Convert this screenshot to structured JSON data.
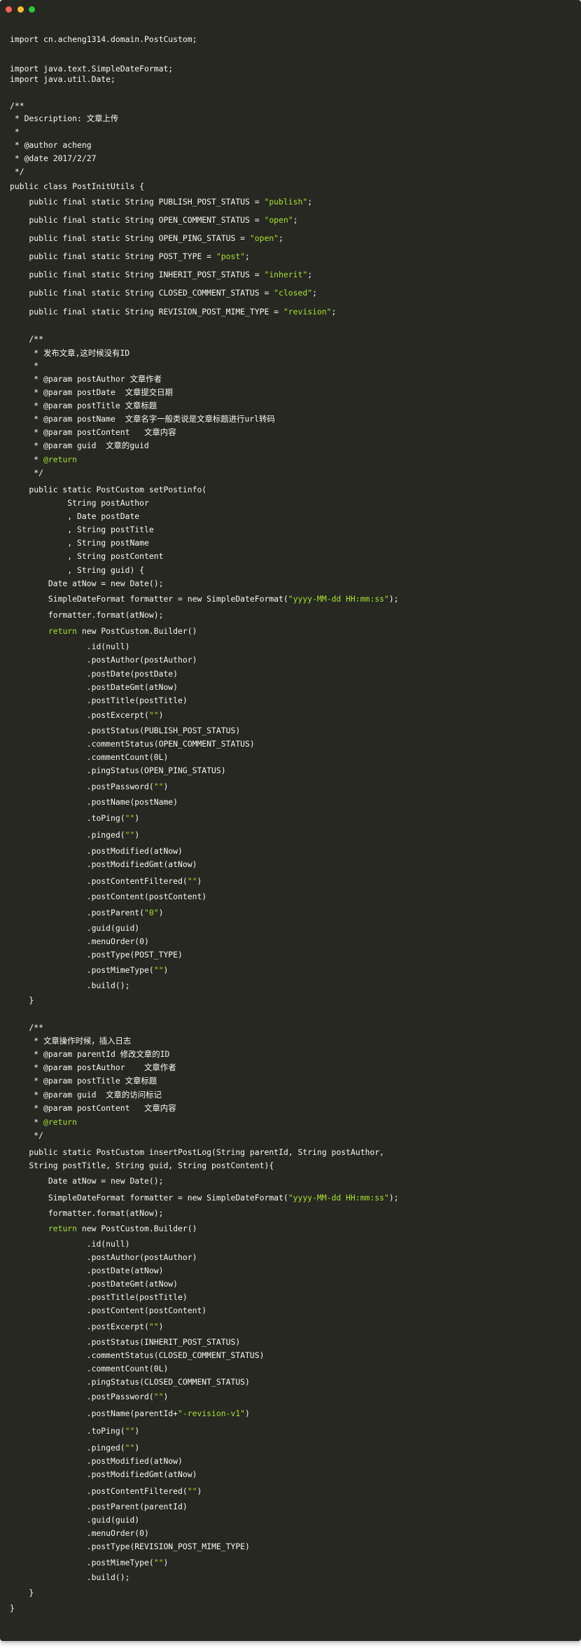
{
  "window": {
    "controls": [
      "close",
      "minimize",
      "maximize"
    ],
    "colors": {
      "background": "#272822",
      "text": "#f8f8f2",
      "string": "#a6e22e",
      "close": "#ff5f56",
      "minimize": "#ffbd2e",
      "maximize": "#27c93f"
    }
  },
  "code": {
    "language": "java",
    "lines": [
      {
        "text": "import cn.acheng1314.domain.PostCustom;"
      },
      {
        "text": "import java.text.SimpleDateFormat;"
      },
      {
        "text": "import java.util.Date;"
      },
      {
        "text": "/**"
      },
      {
        "text": " * Description: 文章上传"
      },
      {
        "text": " *"
      },
      {
        "text": " * @author acheng"
      },
      {
        "text": " * @date 2017/2/27"
      },
      {
        "text": " */"
      },
      {
        "text": "public class PostInitUtils {"
      },
      {
        "parts": [
          {
            "t": "    public final static String PUBLISH_POST_STATUS = "
          },
          {
            "t": "\"publish\"",
            "c": "str"
          },
          {
            "t": ";"
          }
        ]
      },
      {
        "parts": [
          {
            "t": "    public final static String OPEN_COMMENT_STATUS = "
          },
          {
            "t": "\"open\"",
            "c": "str"
          },
          {
            "t": ";"
          }
        ]
      },
      {
        "parts": [
          {
            "t": "    public final static String OPEN_PING_STATUS = "
          },
          {
            "t": "\"open\"",
            "c": "str"
          },
          {
            "t": ";"
          }
        ]
      },
      {
        "parts": [
          {
            "t": "    public final static String POST_TYPE = "
          },
          {
            "t": "\"post\"",
            "c": "str"
          },
          {
            "t": ";"
          }
        ]
      },
      {
        "parts": [
          {
            "t": "    public final static String INHERIT_POST_STATUS = "
          },
          {
            "t": "\"inherit\"",
            "c": "str"
          },
          {
            "t": ";"
          }
        ]
      },
      {
        "parts": [
          {
            "t": "    public final static String CLOSED_COMMENT_STATUS = "
          },
          {
            "t": "\"closed\"",
            "c": "str"
          },
          {
            "t": ";"
          }
        ]
      },
      {
        "parts": [
          {
            "t": "    public final static String REVISION_POST_MIME_TYPE = "
          },
          {
            "t": "\"revision\"",
            "c": "str"
          },
          {
            "t": ";"
          }
        ]
      },
      {
        "text": "    /**"
      },
      {
        "text": "     * 发布文章,这时候没有ID"
      },
      {
        "text": "     *"
      },
      {
        "text": "     * @param postAuthor 文章作者"
      },
      {
        "text": "     * @param postDate  文章提交日期"
      },
      {
        "text": "     * @param postTitle 文章标题"
      },
      {
        "text": "     * @param postName  文章名字一般类说是文章标题进行url转码"
      },
      {
        "text": "     * @param postContent   文章内容"
      },
      {
        "text": "     * @param guid  文章的guid"
      },
      {
        "parts": [
          {
            "t": "     * "
          },
          {
            "t": "@return",
            "c": "kw"
          }
        ]
      },
      {
        "text": "     */"
      },
      {
        "text": "    public static PostCustom setPostinfo("
      },
      {
        "text": "            String postAuthor"
      },
      {
        "text": "            , Date postDate"
      },
      {
        "text": "            , String postTitle"
      },
      {
        "text": "            , String postName"
      },
      {
        "text": "            , String postContent"
      },
      {
        "text": "            , String guid) {"
      },
      {
        "text": "        Date atNow = new Date();"
      },
      {
        "parts": [
          {
            "t": "        SimpleDateFormat formatter = new SimpleDateFormat("
          },
          {
            "t": "\"yyyy-MM-dd HH:mm:ss\"",
            "c": "str"
          },
          {
            "t": ");"
          }
        ]
      },
      {
        "text": "        formatter.format(atNow);"
      },
      {
        "parts": [
          {
            "t": "        "
          },
          {
            "t": "return",
            "c": "kw"
          },
          {
            "t": " new PostCustom.Builder()"
          }
        ]
      },
      {
        "text": "                .id(null)"
      },
      {
        "text": "                .postAuthor(postAuthor)"
      },
      {
        "text": "                .postDate(postDate)"
      },
      {
        "text": "                .postDateGmt(atNow)"
      },
      {
        "text": "                .postTitle(postTitle)"
      },
      {
        "parts": [
          {
            "t": "                .postExcerpt("
          },
          {
            "t": "\"\"",
            "c": "str"
          },
          {
            "t": ")"
          }
        ]
      },
      {
        "text": "                .postStatus(PUBLISH_POST_STATUS)"
      },
      {
        "text": "                .commentStatus(OPEN_COMMENT_STATUS)"
      },
      {
        "text": "                .commentCount(0L)"
      },
      {
        "text": "                .pingStatus(OPEN_PING_STATUS)"
      },
      {
        "parts": [
          {
            "t": "                .postPassword("
          },
          {
            "t": "\"\"",
            "c": "str"
          },
          {
            "t": ")"
          }
        ]
      },
      {
        "text": "                .postName(postName)"
      },
      {
        "parts": [
          {
            "t": "                .toPing("
          },
          {
            "t": "\"\"",
            "c": "str"
          },
          {
            "t": ")"
          }
        ]
      },
      {
        "parts": [
          {
            "t": "                .pinged("
          },
          {
            "t": "\"\"",
            "c": "str"
          },
          {
            "t": ")"
          }
        ]
      },
      {
        "text": "                .postModified(atNow)"
      },
      {
        "text": "                .postModifiedGmt(atNow)"
      },
      {
        "parts": [
          {
            "t": "                .postContentFiltered("
          },
          {
            "t": "\"\"",
            "c": "str"
          },
          {
            "t": ")"
          }
        ]
      },
      {
        "text": "                .postContent(postContent)"
      },
      {
        "parts": [
          {
            "t": "                .postParent("
          },
          {
            "t": "\"0\"",
            "c": "str"
          },
          {
            "t": ")"
          }
        ]
      },
      {
        "text": "                .guid(guid)"
      },
      {
        "text": "                .menuOrder(0)"
      },
      {
        "text": "                .postType(POST_TYPE)"
      },
      {
        "parts": [
          {
            "t": "                .postMimeType("
          },
          {
            "t": "\"\"",
            "c": "str"
          },
          {
            "t": ")"
          }
        ]
      },
      {
        "text": "                .build();"
      },
      {
        "text": "    }"
      },
      {
        "text": "    /**"
      },
      {
        "text": "     * 文章操作时候，插入日志"
      },
      {
        "text": "     * @param parentId 修改文章的ID"
      },
      {
        "text": "     * @param postAuthor    文章作者"
      },
      {
        "text": "     * @param postTitle 文章标题"
      },
      {
        "text": "     * @param guid  文章的访问标记"
      },
      {
        "text": "     * @param postContent   文章内容"
      },
      {
        "parts": [
          {
            "t": "     * "
          },
          {
            "t": "@return",
            "c": "kw"
          }
        ]
      },
      {
        "text": "     */"
      },
      {
        "text": "    public static PostCustom insertPostLog(String parentId, String postAuthor,"
      },
      {
        "text": "    String postTitle, String guid, String postContent){"
      },
      {
        "text": "        Date atNow = new Date();"
      },
      {
        "parts": [
          {
            "t": "        SimpleDateFormat formatter = new SimpleDateFormat("
          },
          {
            "t": "\"yyyy-MM-dd HH:mm:ss\"",
            "c": "str"
          },
          {
            "t": ");"
          }
        ]
      },
      {
        "text": "        formatter.format(atNow);"
      },
      {
        "parts": [
          {
            "t": "        "
          },
          {
            "t": "return",
            "c": "kw"
          },
          {
            "t": " new PostCustom.Builder()"
          }
        ]
      },
      {
        "text": "                .id(null)"
      },
      {
        "text": "                .postAuthor(postAuthor)"
      },
      {
        "text": "                .postDate(atNow)"
      },
      {
        "text": "                .postDateGmt(atNow)"
      },
      {
        "text": "                .postTitle(postTitle)"
      },
      {
        "text": "                .postContent(postContent)"
      },
      {
        "parts": [
          {
            "t": "                .postExcerpt("
          },
          {
            "t": "\"\"",
            "c": "str"
          },
          {
            "t": ")"
          }
        ]
      },
      {
        "text": "                .postStatus(INHERIT_POST_STATUS)"
      },
      {
        "text": "                .commentStatus(CLOSED_COMMENT_STATUS)"
      },
      {
        "text": "                .commentCount(0L)"
      },
      {
        "text": "                .pingStatus(CLOSED_COMMENT_STATUS)"
      },
      {
        "parts": [
          {
            "t": "                .postPassword("
          },
          {
            "t": "\"\"",
            "c": "str"
          },
          {
            "t": ")"
          }
        ]
      },
      {
        "parts": [
          {
            "t": "                .postName(parentId+"
          },
          {
            "t": "\"-revision-v1\"",
            "c": "str"
          },
          {
            "t": ")"
          }
        ]
      },
      {
        "parts": [
          {
            "t": "                .toPing("
          },
          {
            "t": "\"\"",
            "c": "str"
          },
          {
            "t": ")"
          }
        ]
      },
      {
        "parts": [
          {
            "t": "                .pinged("
          },
          {
            "t": "\"\"",
            "c": "str"
          },
          {
            "t": ")"
          }
        ]
      },
      {
        "text": "                .postModified(atNow)"
      },
      {
        "text": "                .postModifiedGmt(atNow)"
      },
      {
        "parts": [
          {
            "t": "                .postContentFiltered("
          },
          {
            "t": "\"\"",
            "c": "str"
          },
          {
            "t": ")"
          }
        ]
      },
      {
        "text": "                .postParent(parentId)"
      },
      {
        "text": "                .guid(guid)"
      },
      {
        "text": "                .menuOrder(0)"
      },
      {
        "text": "                .postType(REVISION_POST_MIME_TYPE)"
      },
      {
        "parts": [
          {
            "t": "                .postMimeType("
          },
          {
            "t": "\"\"",
            "c": "str"
          },
          {
            "t": ")"
          }
        ]
      },
      {
        "text": "                .build();"
      },
      {
        "text": "    }"
      },
      {
        "text": "}"
      }
    ]
  }
}
